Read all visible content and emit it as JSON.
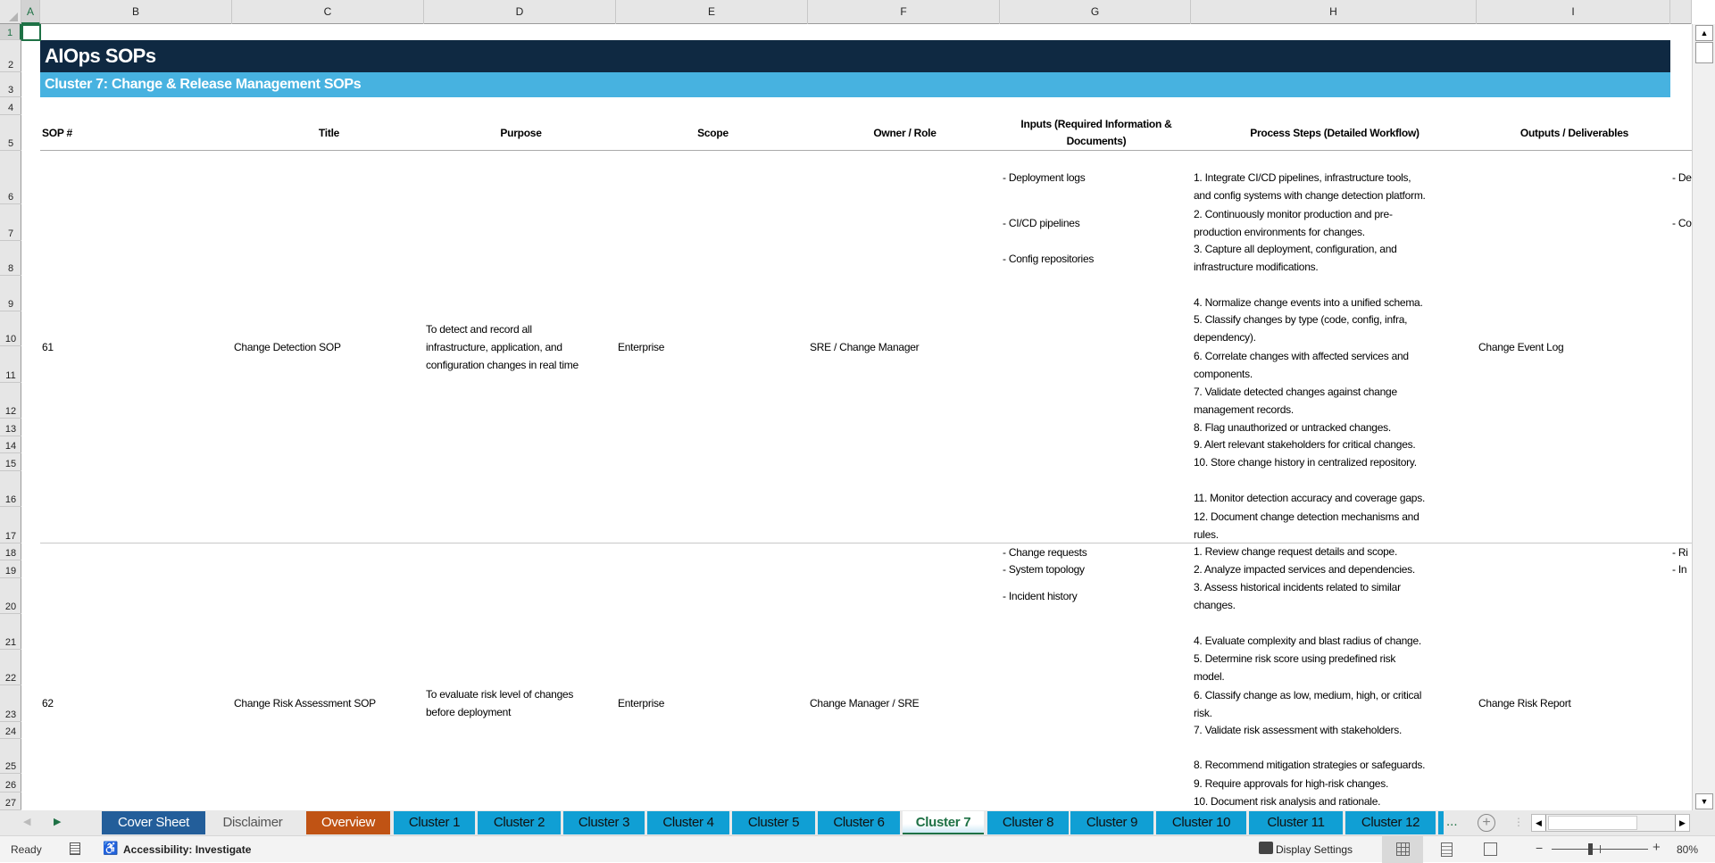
{
  "columns": [
    "A",
    "B",
    "C",
    "D",
    "E",
    "F",
    "G",
    "H",
    "I"
  ],
  "rows": [
    1,
    2,
    3,
    4,
    5,
    6,
    7,
    8,
    9,
    10,
    11,
    12,
    13,
    14,
    15,
    16,
    17,
    18,
    19,
    20,
    21,
    22,
    23,
    24,
    25,
    26,
    27
  ],
  "sheet": {
    "title": "AIOps SOPs",
    "subtitle": "Cluster 7: Change & Release Management SOPs",
    "headers": [
      "SOP #",
      "Title",
      "Purpose",
      "Scope",
      "Owner / Role",
      "Inputs (Required Information &\nDocuments)",
      "Process Steps (Detailed Workflow)",
      "Outputs / Deliverables"
    ],
    "sops": [
      {
        "number": "61",
        "title": "Change Detection SOP",
        "purpose": "To detect and record all\ninfrastructure, application, and\nconfiguration changes in real time",
        "scope": "Enterprise",
        "owner": "SRE / Change Manager",
        "inputs": [
          "- Deployment logs",
          "- CI/CD pipelines",
          "- Config repositories"
        ],
        "steps": [
          "1. Integrate CI/CD pipelines, infrastructure tools,\nand config systems with change detection platform.",
          "2. Continuously monitor production and pre-\nproduction environments for changes.",
          "3. Capture all deployment, configuration, and\ninfrastructure modifications.",
          "4. Normalize change events into a unified schema.",
          "5. Classify changes by type (code, config, infra,\ndependency).",
          "6. Correlate changes with affected services and\ncomponents.",
          "7. Validate detected changes against change\nmanagement records.",
          "8. Flag unauthorized or untracked changes.",
          "9. Alert relevant stakeholders for critical changes.",
          "10. Store change history in centralized repository.",
          "11. Monitor detection accuracy and coverage gaps.",
          "12. Document change detection mechanisms and\nrules."
        ],
        "outputs": "Change Event Log",
        "next_col": [
          "- De",
          "- Co"
        ]
      },
      {
        "number": "62",
        "title": "Change Risk Assessment SOP",
        "purpose": "To evaluate risk level of changes\nbefore deployment",
        "scope": "Enterprise",
        "owner": "Change Manager / SRE",
        "inputs": [
          "- Change requests",
          "- System topology",
          "- Incident history"
        ],
        "steps": [
          "1. Review change request details and scope.",
          "2. Analyze impacted services and dependencies.",
          "3. Assess historical incidents related to similar\nchanges.",
          "4. Evaluate complexity and blast radius of change.",
          "5. Determine risk score using predefined risk\nmodel.",
          "6. Classify change as low, medium, high, or critical\nrisk.",
          "7. Validate risk assessment with stakeholders.",
          "8. Recommend mitigation strategies or safeguards.",
          "9. Require approvals for high-risk changes.",
          "10. Document risk analysis and rationale."
        ],
        "outputs": "Change Risk Report",
        "next_col": [
          "- Ri",
          "- In"
        ]
      }
    ]
  },
  "tabs": [
    {
      "label": "Cover Sheet",
      "bg": "#235E9A",
      "fg": "#ffffff"
    },
    {
      "label": "Disclaimer",
      "bg": "#e9e9e9",
      "fg": "#555555"
    },
    {
      "label": "Overview",
      "bg": "#C05314",
      "fg": "#ffffff"
    },
    {
      "label": "Cluster 1",
      "bg": "#109FD4",
      "fg": "#111111"
    },
    {
      "label": "Cluster 2",
      "bg": "#109FD4",
      "fg": "#111111"
    },
    {
      "label": "Cluster 3",
      "bg": "#109FD4",
      "fg": "#111111"
    },
    {
      "label": "Cluster 4",
      "bg": "#109FD4",
      "fg": "#111111"
    },
    {
      "label": "Cluster 5",
      "bg": "#109FD4",
      "fg": "#111111"
    },
    {
      "label": "Cluster 6",
      "bg": "#109FD4",
      "fg": "#111111"
    },
    {
      "label": "Cluster 7",
      "bg": "#ffffff",
      "fg": "#1E7145",
      "active": true
    },
    {
      "label": "Cluster 8",
      "bg": "#109FD4",
      "fg": "#111111"
    },
    {
      "label": "Cluster 9",
      "bg": "#109FD4",
      "fg": "#111111"
    },
    {
      "label": "Cluster 10",
      "bg": "#109FD4",
      "fg": "#111111"
    },
    {
      "label": "Cluster 11",
      "bg": "#109FD4",
      "fg": "#111111"
    },
    {
      "label": "Cluster 12",
      "bg": "#109FD4",
      "fg": "#111111"
    }
  ],
  "tab_more": "...",
  "status": {
    "ready": "Ready",
    "accessibility": "Accessibility: Investigate",
    "display_settings": "Display Settings",
    "zoom": "80%",
    "zoom_fraction": 0.4
  },
  "colors": {
    "title_bg": "#0F2942",
    "subtitle_bg": "#47B2E0",
    "accent": "#1E7145"
  }
}
